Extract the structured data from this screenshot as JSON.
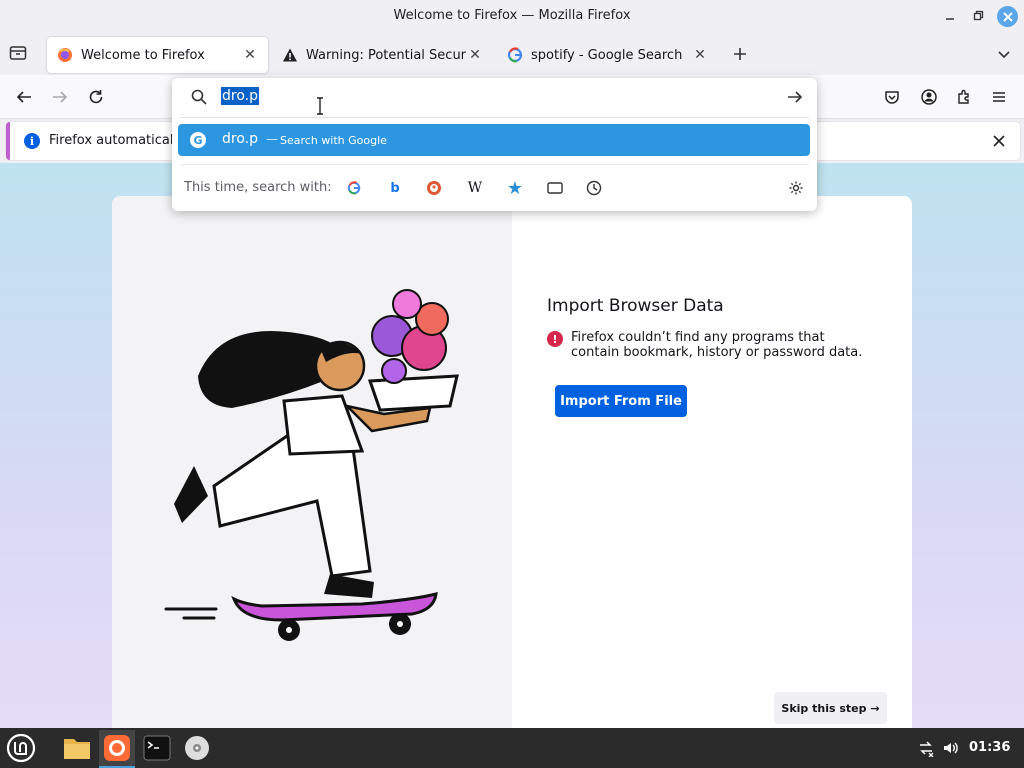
{
  "window": {
    "title": "Welcome to Firefox — Mozilla Firefox"
  },
  "tabs": [
    {
      "label": "Welcome to Firefox",
      "icon": "firefox-icon",
      "active": true
    },
    {
      "label": "Warning: Potential Security",
      "icon": "warning-icon",
      "active": false
    },
    {
      "label": "spotify - Google Search",
      "icon": "google-icon",
      "active": false
    }
  ],
  "urlbar": {
    "value": "dro.p",
    "suggestion_text": "dro.p",
    "suggestion_dash": "—",
    "suggestion_action": "Search with Google",
    "oneoff_label": "This time, search with:",
    "oneoffs": [
      "Google",
      "Bing",
      "DuckDuckGo",
      "Wikipedia",
      "Bookmarks",
      "Tabs",
      "History"
    ]
  },
  "notification": {
    "text": "Firefox automatically"
  },
  "import_card": {
    "title": "Import Browser Data",
    "message": "Firefox couldn’t find any programs that contain bookmark, history or password data.",
    "button": "Import From File",
    "skip": "Skip this step →"
  },
  "taskbar": {
    "clock": "01:36"
  },
  "colors": {
    "accent": "#0061e0",
    "suggestion_highlight": "#2c97e0",
    "notification_border": "#c060d0"
  }
}
